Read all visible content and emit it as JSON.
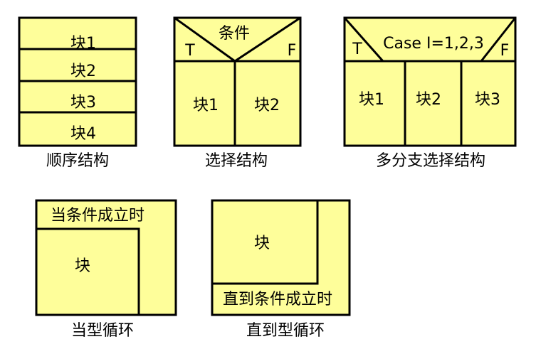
{
  "sequence": {
    "blocks": [
      "块1",
      "块2",
      "块3",
      "块4"
    ],
    "caption": "顺序结构"
  },
  "selection": {
    "condition": "条件",
    "true_label": "T",
    "false_label": "F",
    "blocks": [
      "块1",
      "块2"
    ],
    "caption": "选择结构"
  },
  "multi_branch": {
    "condition": "Case I=1,2,3",
    "true_label": "T",
    "false_label": "F",
    "blocks": [
      "块1",
      "块2",
      "块3"
    ],
    "caption": "多分支选择结构"
  },
  "while_loop": {
    "condition": "当条件成立时",
    "block": "块",
    "caption": "当型循环"
  },
  "until_loop": {
    "condition": "直到条件成立时",
    "block": "块",
    "caption": "直到型循环"
  }
}
